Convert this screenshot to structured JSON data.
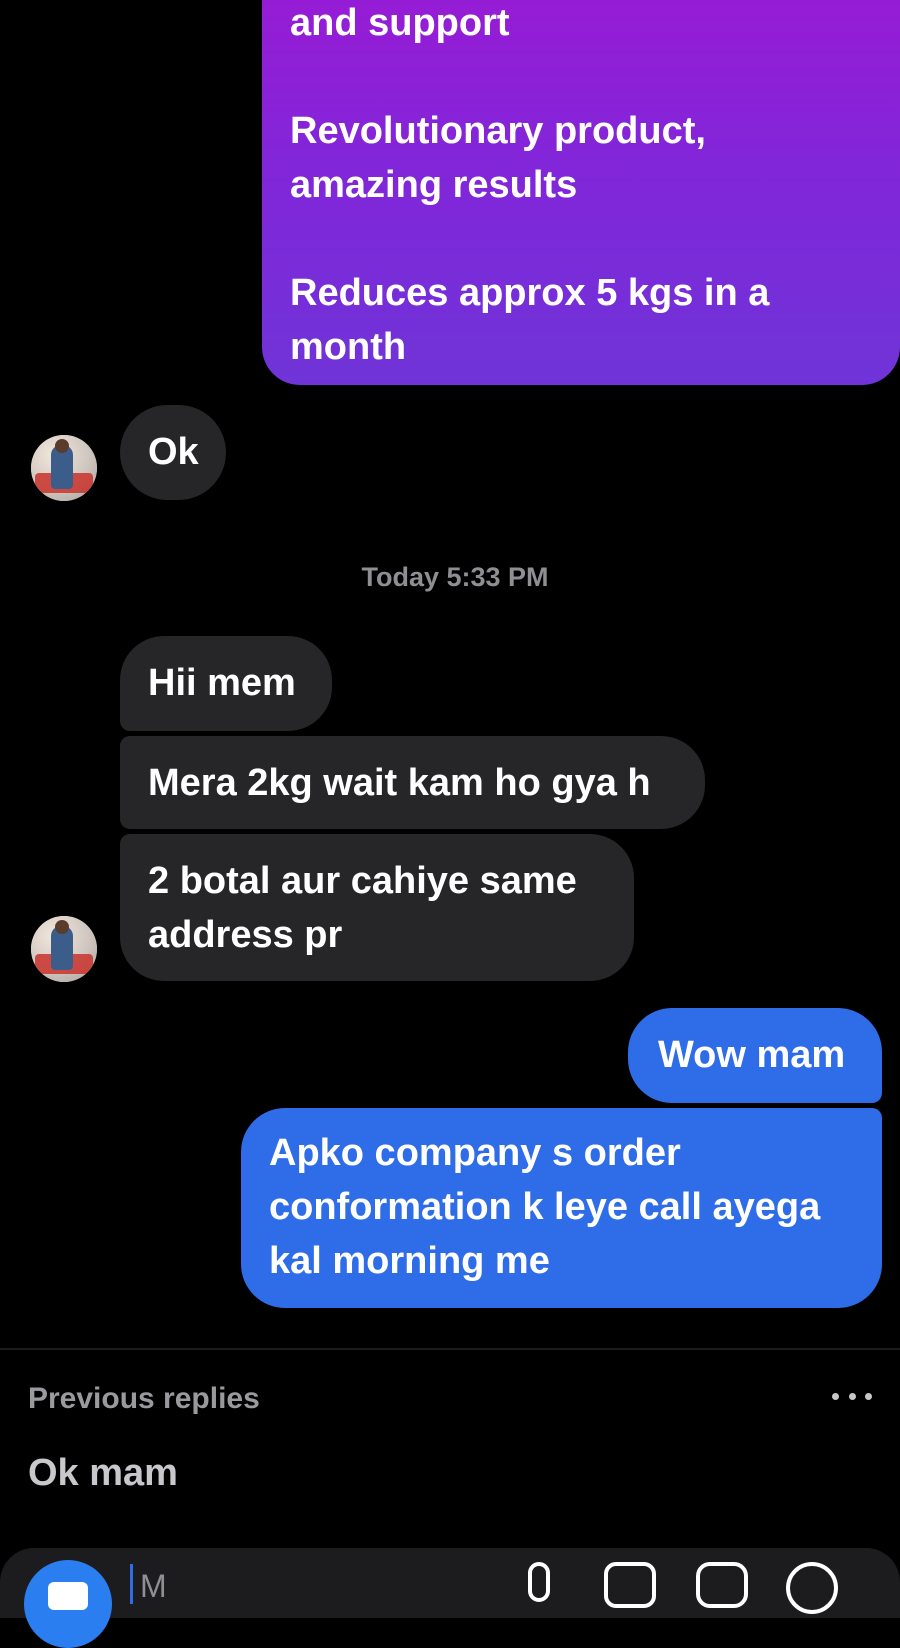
{
  "messages": {
    "outgoing_promo": "and support\n\nRevolutionary product,\namazing results\n\nReduces approx 5 kgs in a\nmonth",
    "incoming_ok": "Ok",
    "timestamp": "Today 5:33 PM",
    "incoming_1": "Hii mem",
    "incoming_2": "Mera 2kg wait kam ho gya h",
    "incoming_3": "2 botal aur cahiye same\naddress pr",
    "outgoing_1": "Wow mam",
    "outgoing_2": "Apko company s order\nconformation k leye call ayega\nkal morning me"
  },
  "replies": {
    "label": "Previous replies",
    "items": [
      "Ok mam"
    ]
  },
  "composer": {
    "placeholder": "M"
  },
  "colors": {
    "background": "#000000",
    "incoming_bubble": "#262628",
    "outgoing_bubble": "#2f6de8",
    "promo_gradient_top": "#9a1ad4",
    "promo_gradient_bottom": "#6f34d8",
    "camera_button": "#2b7ef0"
  },
  "icons": [
    "camera-icon",
    "microphone-icon",
    "gallery-icon",
    "sticker-icon",
    "plus-icon",
    "more-options-icon"
  ]
}
